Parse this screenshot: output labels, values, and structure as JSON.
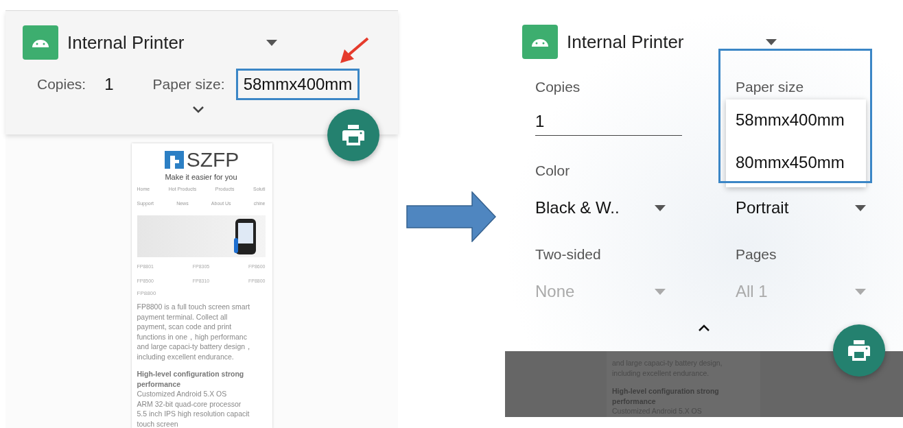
{
  "left_screen": {
    "printer": {
      "name": "Internal Printer"
    },
    "summary": [
      {
        "label": "Copies:",
        "value": "1",
        "highlighted": false
      },
      {
        "label": "Paper size:",
        "value": "58mmx400mm",
        "highlighted": true
      }
    ],
    "preview": {
      "logo": "SZFP",
      "tagline": "Make it easier for you",
      "nav": [
        [
          "Home",
          "Hot Products",
          "Products",
          "Soluti"
        ],
        [
          "Support",
          "News",
          "About Us",
          "chine"
        ]
      ],
      "products": [
        [
          "FP8801",
          "FP8305",
          "FP8600"
        ],
        [
          "FP8500",
          "FP8310",
          "FP8800"
        ]
      ],
      "caption": "FP8800",
      "paragraph": [
        "FP8800 is a full touch screen smart",
        "payment terminal. Collect all",
        "payment, scan code and print",
        "functions in one，high performanc",
        "and large capaci-ty battery design，",
        "including excellent endurance."
      ],
      "heading": [
        "High-level configuration strong",
        "performance"
      ],
      "specs": [
        "Customized Android 5.X OS",
        "ARM 32-bit quad-core processor",
        "5.5 inch IPS high resolution capacit",
        "touch screen"
      ]
    }
  },
  "right_screen": {
    "printer": {
      "name": "Internal Printer"
    },
    "fields": [
      {
        "kind": "text",
        "label": "Copies",
        "value": "1",
        "disabled": false
      },
      {
        "kind": "menu",
        "label": "Paper size",
        "options": [
          "58mmx400mm",
          "80mmx450mm"
        ],
        "highlighted": true
      },
      {
        "kind": "dropdown",
        "label": "Color",
        "value": "Black & W..",
        "disabled": false
      },
      {
        "kind": "dropdown",
        "value": "Portrait",
        "disabled": false
      },
      {
        "kind": "dropdown",
        "label": "Two-sided",
        "value": "None",
        "disabled": true
      },
      {
        "kind": "dropdown",
        "label": "Pages",
        "value": "All 1",
        "disabled": true
      }
    ],
    "preview": [
      "and large capaci-ty battery design,",
      "including excellent endurance."
    ],
    "preview_heading": [
      "High-level configuration strong",
      "performance"
    ],
    "preview_specs": [
      "Customized Android 5.X OS"
    ]
  }
}
